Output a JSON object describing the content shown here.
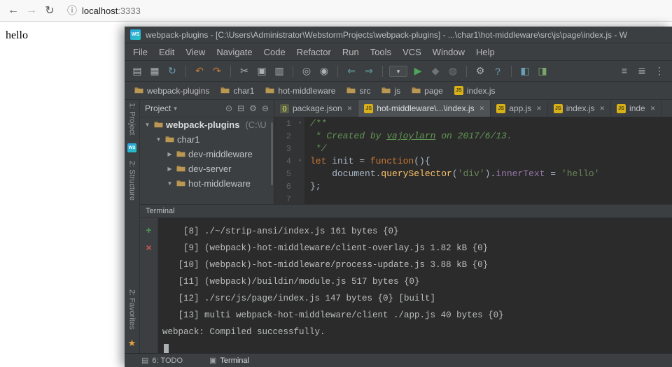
{
  "palette": {
    "panel_bg": "#3c3f41",
    "editor_bg": "#2b2b2b",
    "run_green": "#4fa65a",
    "error_red": "#c75450",
    "folder_tan": "#ba9752",
    "js_yellow": "#d8b018",
    "favorites_orange": "#e8a33d"
  },
  "browser": {
    "back_icon": "←",
    "forward_icon": "→",
    "refresh_icon": "↻",
    "info_icon": "ⓘ",
    "url_host": "localhost",
    "url_port": ":3333",
    "page_text": "hello"
  },
  "ide": {
    "logo_text": "WS",
    "title": "webpack-plugins - [C:\\Users\\Administrator\\WebstormProjects\\webpack-plugins] - ...\\char1\\hot-middleware\\src\\js\\page\\index.js - W",
    "menu": [
      "File",
      "Edit",
      "View",
      "Navigate",
      "Code",
      "Refactor",
      "Run",
      "Tools",
      "VCS",
      "Window",
      "Help"
    ],
    "toolbar": {
      "left": [
        {
          "name": "open-project-icon",
          "glyph": "▤",
          "color": "#adb0b2"
        },
        {
          "name": "save-all-icon",
          "glyph": "▦",
          "color": "#adb0b2"
        },
        {
          "name": "sync-icon",
          "glyph": "↻",
          "color": "#6a9fb5"
        },
        {
          "sep": true
        },
        {
          "name": "undo-icon",
          "glyph": "↶",
          "color": "#c77d3b"
        },
        {
          "name": "redo-icon",
          "glyph": "↷",
          "color": "#c77d3b"
        },
        {
          "sep": true
        },
        {
          "name": "cut-icon",
          "glyph": "✂",
          "color": "#adb0b2"
        },
        {
          "name": "copy-icon",
          "glyph": "▣",
          "color": "#adb0b2"
        },
        {
          "name": "paste-icon",
          "glyph": "▥",
          "color": "#adb0b2"
        },
        {
          "sep": true
        },
        {
          "name": "find-icon",
          "glyph": "◎",
          "color": "#adb0b2"
        },
        {
          "name": "replace-icon",
          "glyph": "◉",
          "color": "#adb0b2"
        },
        {
          "sep": true
        },
        {
          "name": "nav-back-icon",
          "glyph": "⇐",
          "color": "#5f9ea0"
        },
        {
          "name": "nav-forward-icon",
          "glyph": "⇒",
          "color": "#5f9ea0"
        },
        {
          "sep": true
        },
        {
          "name": "run-config-dropdown",
          "glyph": "▾",
          "color": "#c3c6c8",
          "box": true
        },
        {
          "name": "run-icon",
          "glyph": "▶",
          "color": "#4fa65a"
        },
        {
          "name": "debug-icon",
          "glyph": "◆",
          "color": "#6f7577"
        },
        {
          "name": "coverage-icon",
          "glyph": "◍",
          "color": "#6f7577"
        },
        {
          "sep": true
        },
        {
          "name": "settings-wrench-icon",
          "glyph": "⚙",
          "color": "#adb0b2"
        },
        {
          "name": "help-icon",
          "glyph": "?",
          "color": "#6a9fb5"
        },
        {
          "sep": true
        },
        {
          "name": "project-structure-icon",
          "glyph": "◧",
          "color": "#6a9fb5"
        },
        {
          "name": "modules-icon",
          "glyph": "◨",
          "color": "#79a66a"
        }
      ],
      "right": [
        {
          "name": "list-view-icon",
          "glyph": "≡",
          "color": "#adb0b2"
        },
        {
          "name": "detail-view-icon",
          "glyph": "≣",
          "color": "#adb0b2"
        },
        {
          "name": "more-options-icon",
          "glyph": "⋮",
          "color": "#adb0b2"
        }
      ]
    },
    "breadcrumbs": [
      {
        "label": "webpack-plugins",
        "type": "folder"
      },
      {
        "label": "char1",
        "type": "folder"
      },
      {
        "label": "hot-middleware",
        "type": "folder"
      },
      {
        "label": "src",
        "type": "folder"
      },
      {
        "label": "js",
        "type": "folder"
      },
      {
        "label": "page",
        "type": "folder"
      },
      {
        "label": "index.js",
        "type": "file"
      }
    ],
    "project_panel": {
      "header": "Project",
      "caret": "▾",
      "header_icons": [
        {
          "name": "locate-file-icon",
          "glyph": "⊙"
        },
        {
          "name": "collapse-all-icon",
          "glyph": "⊟"
        },
        {
          "name": "settings-gear-icon",
          "glyph": "⚙"
        },
        {
          "name": "hide-panel-icon",
          "glyph": "⊖"
        }
      ],
      "tree": [
        {
          "label": "webpack-plugins",
          "suffix": " (C:\\U",
          "expanded": true,
          "level": 0,
          "bold": true
        },
        {
          "label": "char1",
          "expanded": true,
          "level": 1
        },
        {
          "label": "dev-middleware",
          "expanded": false,
          "level": 2
        },
        {
          "label": "dev-server",
          "expanded": false,
          "level": 2
        },
        {
          "label": "hot-middleware",
          "expanded": true,
          "level": 2
        }
      ]
    },
    "tabs": [
      {
        "label": "package.json",
        "icon": "json",
        "active": false
      },
      {
        "label": "hot-middleware\\...\\index.js",
        "icon": "js",
        "active": true
      },
      {
        "label": "app.js",
        "icon": "js",
        "active": false
      },
      {
        "label": "index.js",
        "icon": "js",
        "active": false
      },
      {
        "label": "inde",
        "icon": "js",
        "active": false
      }
    ],
    "editor": {
      "lines": [
        {
          "num": "1",
          "fold": true,
          "tokens": [
            {
              "t": "/**",
              "c": "com"
            }
          ]
        },
        {
          "num": "2",
          "tokens": [
            {
              "t": " * Created by ",
              "c": "com"
            },
            {
              "t": "vajoylarn",
              "c": "com link"
            },
            {
              "t": " on 2017/6/13.",
              "c": "com"
            }
          ]
        },
        {
          "num": "3",
          "tokens": [
            {
              "t": " */",
              "c": "com"
            }
          ]
        },
        {
          "num": "4",
          "fold": true,
          "tokens": [
            {
              "t": "let",
              "c": "kw"
            },
            {
              "t": " init = ",
              "c": "plain"
            },
            {
              "t": "function",
              "c": "kw"
            },
            {
              "t": "(){",
              "c": "plain"
            }
          ]
        },
        {
          "num": "5",
          "tokens": [
            {
              "t": "    document.",
              "c": "plain"
            },
            {
              "t": "querySelector",
              "c": "fn"
            },
            {
              "t": "(",
              "c": "plain"
            },
            {
              "t": "'div'",
              "c": "str"
            },
            {
              "t": ").",
              "c": "plain"
            },
            {
              "t": "innerText",
              "c": "field"
            },
            {
              "t": " = ",
              "c": "plain"
            },
            {
              "t": "'hello'",
              "c": "str"
            }
          ]
        },
        {
          "num": "6",
          "tokens": [
            {
              "t": "};",
              "c": "plain"
            }
          ]
        },
        {
          "num": "7",
          "tokens": []
        }
      ]
    },
    "terminal": {
      "title": "Terminal",
      "gutter": [
        {
          "name": "add-session-icon",
          "glyph": "+",
          "color": "#4a9b54"
        },
        {
          "name": "close-session-icon",
          "glyph": "×",
          "color": "#c75450"
        }
      ],
      "lines": [
        "    [8] ./~/strip-ansi/index.js 161 bytes {0}",
        "    [9] (webpack)-hot-middleware/client-overlay.js 1.82 kB {0}",
        "   [10] (webpack)-hot-middleware/process-update.js 3.88 kB {0}",
        "   [11] (webpack)/buildin/module.js 517 bytes {0}",
        "   [12] ./src/js/page/index.js 147 bytes {0} [built]",
        "   [13] multi webpack-hot-middleware/client ./app.js 40 bytes {0}",
        "webpack: Compiled successfully."
      ]
    },
    "tool_stripes": {
      "project": "1: Project",
      "structure": "2: Structure",
      "favorites": "2: Favorites",
      "star_icon": "★"
    },
    "statusbar": {
      "items": [
        {
          "icon": "▤",
          "icon_name": "todo-icon",
          "label": "6: TODO",
          "active": false
        },
        {
          "icon": "▣",
          "icon_name": "terminal-icon",
          "label": "Terminal",
          "active": true
        }
      ]
    }
  }
}
